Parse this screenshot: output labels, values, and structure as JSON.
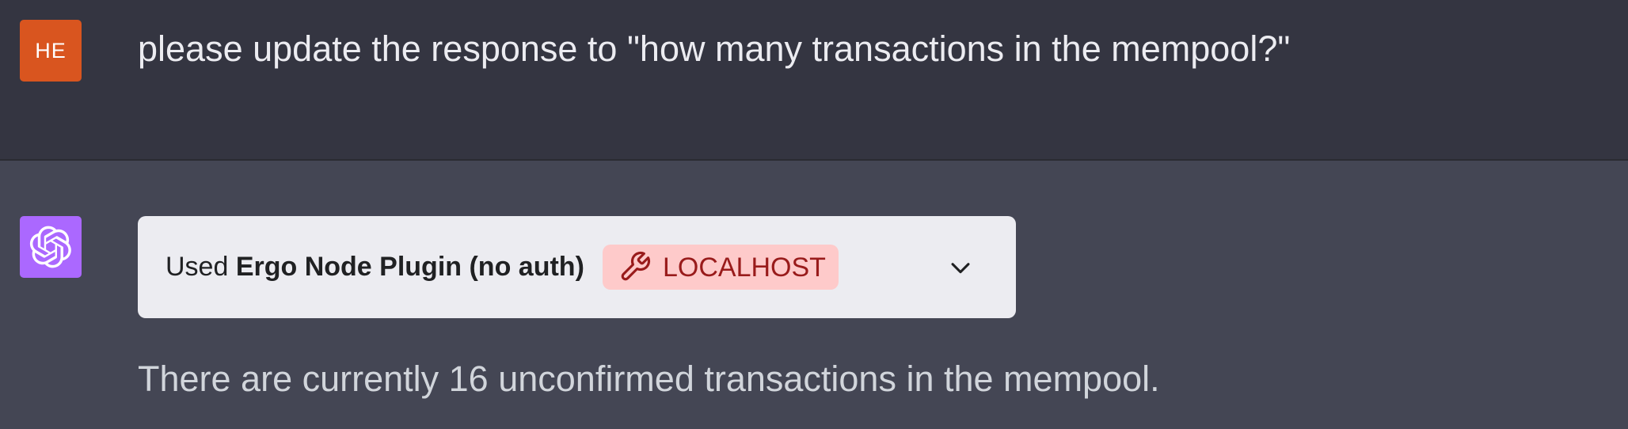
{
  "user_message": {
    "avatar_initials": "HE",
    "avatar_color": "#d9551f",
    "text": "please update the response to \"how many transactions in the mempool?\""
  },
  "assistant_message": {
    "avatar_icon": "openai-logo-icon",
    "avatar_color": "#ab68ff",
    "plugin_card": {
      "used_prefix": "Used",
      "plugin_name": "Ergo Node Plugin (no auth)",
      "badge_icon": "wrench-icon",
      "badge_label": "LOCALHOST",
      "expand_icon": "chevron-down-icon"
    },
    "text": "There are currently 16 unconfirmed transactions in the mempool."
  }
}
